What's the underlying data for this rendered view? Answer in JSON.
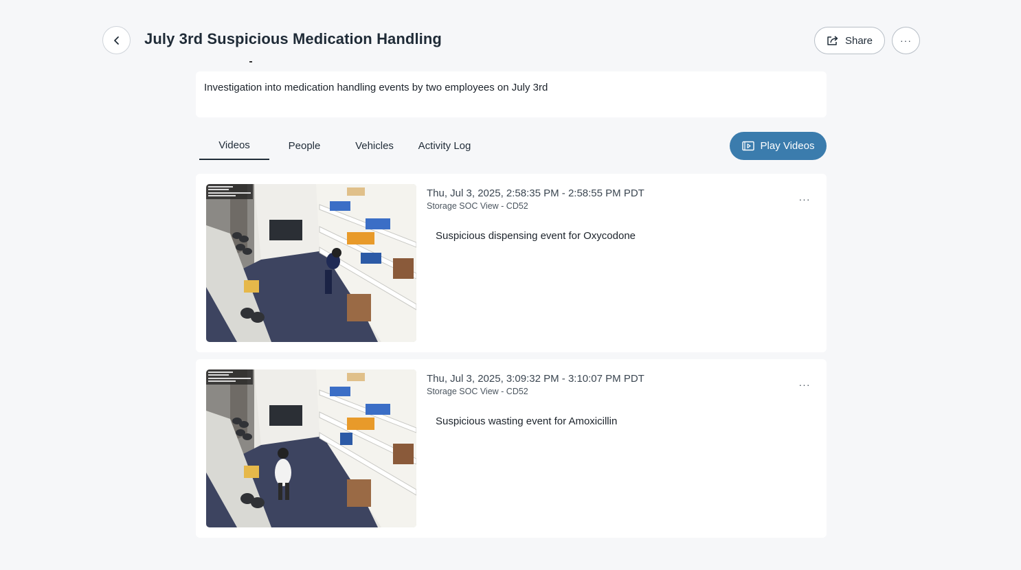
{
  "header": {
    "title": "July 3rd Suspicious Medication Handling",
    "share_label": "Share",
    "more_label": "···"
  },
  "description": "Investigation into medication handling events by two employees on July 3rd",
  "tabs": [
    {
      "label": "Videos",
      "active": true
    },
    {
      "label": "People",
      "active": false
    },
    {
      "label": "Vehicles",
      "active": false
    },
    {
      "label": "Activity Log",
      "active": false
    }
  ],
  "play_button_label": "Play Videos",
  "events": [
    {
      "time": "Thu, Jul 3, 2025, 2:58:35 PM - 2:58:55 PM PDT",
      "camera": "Storage SOC View - CD52",
      "description": "Suspicious dispensing event for Oxycodone",
      "more_label": "···"
    },
    {
      "time": "Thu, Jul 3, 2025, 3:09:32 PM - 3:10:07 PM PDT",
      "camera": "Storage SOC View - CD52",
      "description": "Suspicious wasting event for Amoxicillin",
      "more_label": "···"
    }
  ],
  "colors": {
    "accent": "#3b7cad",
    "background": "#f6f7f9",
    "card": "#ffffff"
  },
  "icons": [
    "chevron-left-icon",
    "share-icon",
    "more-horizontal-icon",
    "play-video-icon"
  ]
}
